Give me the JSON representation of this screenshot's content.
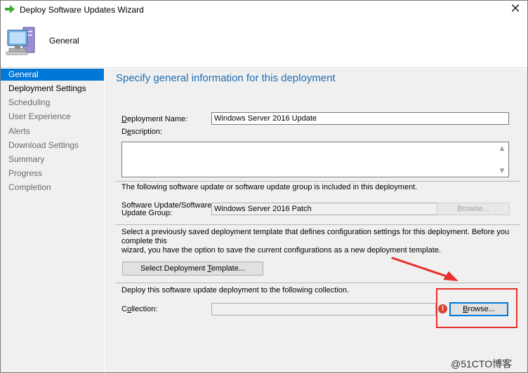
{
  "window": {
    "title": "Deploy Software Updates Wizard",
    "close_glyph": "✕"
  },
  "header": {
    "page_title": "General"
  },
  "sidebar": {
    "items": [
      {
        "label": "General"
      },
      {
        "label": "Deployment Settings"
      },
      {
        "label": "Scheduling"
      },
      {
        "label": "User Experience"
      },
      {
        "label": "Alerts"
      },
      {
        "label": "Download Settings"
      },
      {
        "label": "Summary"
      },
      {
        "label": "Progress"
      },
      {
        "label": "Completion"
      }
    ]
  },
  "main": {
    "heading": "Specify general information for this deployment",
    "deployment_name": {
      "label_accel": "D",
      "label_rest": "eployment Name:",
      "value": "Windows Server 2016 Update"
    },
    "description": {
      "label_pre": "D",
      "label_accel": "e",
      "label_rest": "scription:",
      "value": ""
    },
    "group_note": "The following software update or software update group is included in this deployment.",
    "update_group": {
      "label_line1": "Software Update/Software",
      "label_line2": "Update Group:",
      "value": "Windows Server 2016 Patch",
      "browse_label": "Browse..."
    },
    "template_note_line1": "Select a previously saved deployment template that defines configuration settings for this deployment. Before you complete this",
    "template_note_line2": "wizard, you have the option to save the current configurations as a new deployment template.",
    "template_button": {
      "pre": "Select Deployment ",
      "accel": "T",
      "rest": "emplate..."
    },
    "collection_note": "Deploy this software update deployment to the following collection.",
    "collection": {
      "label_pre": "C",
      "label_accel": "o",
      "label_rest": "llection:",
      "value": "",
      "browse_pre": "",
      "browse_accel": "B",
      "browse_rest": "rowse..."
    },
    "error_glyph": "!"
  },
  "watermark": "@51CTO博客",
  "colors": {
    "accent": "#0078d7",
    "heading": "#1e6eb4",
    "annotation": "#e8302a"
  },
  "icons": [
    "green-arrow-icon",
    "computer-icon",
    "error-icon",
    "scroll-up-icon",
    "scroll-down-icon"
  ]
}
